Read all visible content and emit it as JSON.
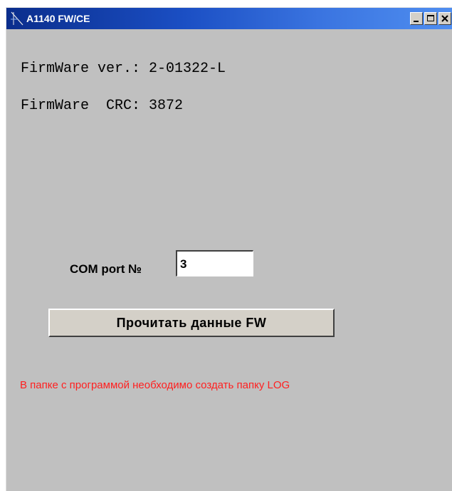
{
  "window": {
    "title": "A1140 FW/CE"
  },
  "info": {
    "firmware_version_line": "FirmWare ver.: 2-01322-L",
    "firmware_crc_line": "FirmWare  CRC: 3872"
  },
  "com_port": {
    "label": "COM port №",
    "value": "3"
  },
  "actions": {
    "read_button_label": "Прочитать  данные FW"
  },
  "notice": {
    "warning_text": "В папке с программой необходимо создать папку LOG",
    "color": "#ff2020"
  },
  "icons": {
    "app": "app-icon",
    "minimize": "minimize-icon",
    "maximize": "maximize-icon",
    "close": "close-icon"
  },
  "colors": {
    "titlebar_start": "#0a2d8c",
    "titlebar_end": "#4f8ef0",
    "client_background": "#c0c0c0"
  }
}
